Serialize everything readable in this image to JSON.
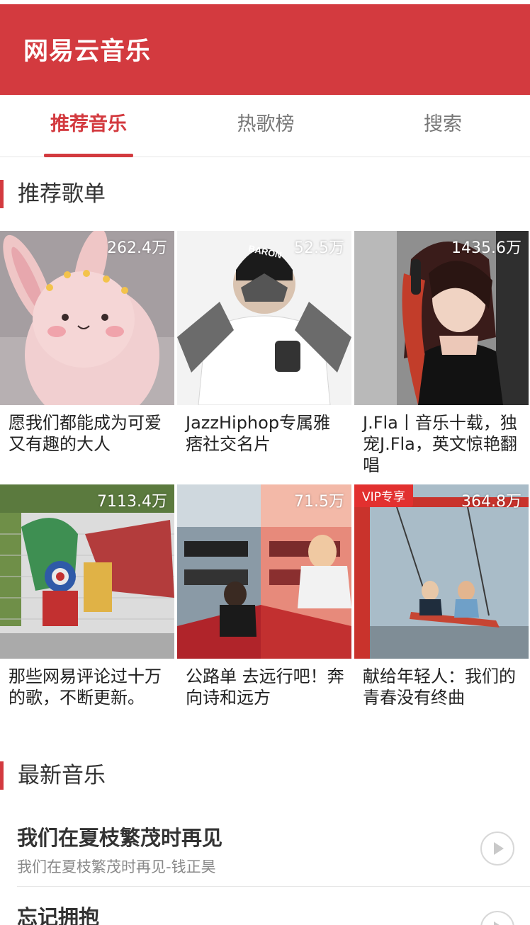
{
  "header": {
    "title": "网易云音乐",
    "color": "#d33a3f"
  },
  "tabs": [
    {
      "label": "推荐音乐",
      "active": true
    },
    {
      "label": "热歌榜",
      "active": false
    },
    {
      "label": "搜索",
      "active": false
    }
  ],
  "sections": {
    "recommended": "推荐歌单",
    "latest": "最新音乐"
  },
  "playlists": [
    {
      "count": "262.4万",
      "title": "愿我们都能成为可爱又有趣的大人",
      "vip": ""
    },
    {
      "count": "52.5万",
      "title": "JazzHiphop专属雅痞社交名片",
      "vip": ""
    },
    {
      "count": "1435.6万",
      "title": "J.Fla丨音乐十载，独宠J.Fla，英文惊艳翻唱",
      "vip": ""
    },
    {
      "count": "7113.4万",
      "title": "那些网易评论过十万的歌，不断更新。",
      "vip": ""
    },
    {
      "count": "71.5万",
      "title": "公路单 去远行吧！奔向诗和远方",
      "vip": ""
    },
    {
      "count": "364.8万",
      "title": "献给年轻人：我们的青春没有终曲",
      "vip": "VIP专享"
    }
  ],
  "cover_logo_text": "BARON",
  "songs": [
    {
      "title": "我们在夏枝繁茂时再见",
      "subtitle": "我们在夏枝繁茂时再见-钱正昊",
      "icon": "play-circle-icon"
    },
    {
      "title": "忘记拥抱",
      "subtitle": "",
      "icon": "play-circle-icon"
    }
  ]
}
